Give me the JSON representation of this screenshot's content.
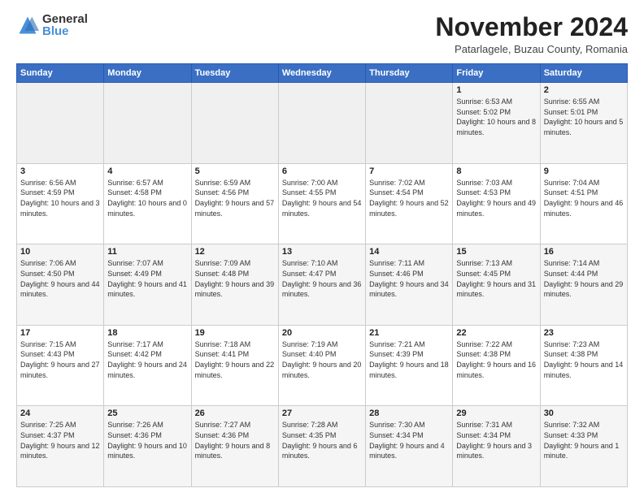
{
  "header": {
    "logo_general": "General",
    "logo_blue": "Blue",
    "month_title": "November 2024",
    "location": "Patarlagele, Buzau County, Romania"
  },
  "days_of_week": [
    "Sunday",
    "Monday",
    "Tuesday",
    "Wednesday",
    "Thursday",
    "Friday",
    "Saturday"
  ],
  "weeks": [
    [
      {
        "day": "",
        "info": ""
      },
      {
        "day": "",
        "info": ""
      },
      {
        "day": "",
        "info": ""
      },
      {
        "day": "",
        "info": ""
      },
      {
        "day": "",
        "info": ""
      },
      {
        "day": "1",
        "info": "Sunrise: 6:53 AM\nSunset: 5:02 PM\nDaylight: 10 hours and 8 minutes."
      },
      {
        "day": "2",
        "info": "Sunrise: 6:55 AM\nSunset: 5:01 PM\nDaylight: 10 hours and 5 minutes."
      }
    ],
    [
      {
        "day": "3",
        "info": "Sunrise: 6:56 AM\nSunset: 4:59 PM\nDaylight: 10 hours and 3 minutes."
      },
      {
        "day": "4",
        "info": "Sunrise: 6:57 AM\nSunset: 4:58 PM\nDaylight: 10 hours and 0 minutes."
      },
      {
        "day": "5",
        "info": "Sunrise: 6:59 AM\nSunset: 4:56 PM\nDaylight: 9 hours and 57 minutes."
      },
      {
        "day": "6",
        "info": "Sunrise: 7:00 AM\nSunset: 4:55 PM\nDaylight: 9 hours and 54 minutes."
      },
      {
        "day": "7",
        "info": "Sunrise: 7:02 AM\nSunset: 4:54 PM\nDaylight: 9 hours and 52 minutes."
      },
      {
        "day": "8",
        "info": "Sunrise: 7:03 AM\nSunset: 4:53 PM\nDaylight: 9 hours and 49 minutes."
      },
      {
        "day": "9",
        "info": "Sunrise: 7:04 AM\nSunset: 4:51 PM\nDaylight: 9 hours and 46 minutes."
      }
    ],
    [
      {
        "day": "10",
        "info": "Sunrise: 7:06 AM\nSunset: 4:50 PM\nDaylight: 9 hours and 44 minutes."
      },
      {
        "day": "11",
        "info": "Sunrise: 7:07 AM\nSunset: 4:49 PM\nDaylight: 9 hours and 41 minutes."
      },
      {
        "day": "12",
        "info": "Sunrise: 7:09 AM\nSunset: 4:48 PM\nDaylight: 9 hours and 39 minutes."
      },
      {
        "day": "13",
        "info": "Sunrise: 7:10 AM\nSunset: 4:47 PM\nDaylight: 9 hours and 36 minutes."
      },
      {
        "day": "14",
        "info": "Sunrise: 7:11 AM\nSunset: 4:46 PM\nDaylight: 9 hours and 34 minutes."
      },
      {
        "day": "15",
        "info": "Sunrise: 7:13 AM\nSunset: 4:45 PM\nDaylight: 9 hours and 31 minutes."
      },
      {
        "day": "16",
        "info": "Sunrise: 7:14 AM\nSunset: 4:44 PM\nDaylight: 9 hours and 29 minutes."
      }
    ],
    [
      {
        "day": "17",
        "info": "Sunrise: 7:15 AM\nSunset: 4:43 PM\nDaylight: 9 hours and 27 minutes."
      },
      {
        "day": "18",
        "info": "Sunrise: 7:17 AM\nSunset: 4:42 PM\nDaylight: 9 hours and 24 minutes."
      },
      {
        "day": "19",
        "info": "Sunrise: 7:18 AM\nSunset: 4:41 PM\nDaylight: 9 hours and 22 minutes."
      },
      {
        "day": "20",
        "info": "Sunrise: 7:19 AM\nSunset: 4:40 PM\nDaylight: 9 hours and 20 minutes."
      },
      {
        "day": "21",
        "info": "Sunrise: 7:21 AM\nSunset: 4:39 PM\nDaylight: 9 hours and 18 minutes."
      },
      {
        "day": "22",
        "info": "Sunrise: 7:22 AM\nSunset: 4:38 PM\nDaylight: 9 hours and 16 minutes."
      },
      {
        "day": "23",
        "info": "Sunrise: 7:23 AM\nSunset: 4:38 PM\nDaylight: 9 hours and 14 minutes."
      }
    ],
    [
      {
        "day": "24",
        "info": "Sunrise: 7:25 AM\nSunset: 4:37 PM\nDaylight: 9 hours and 12 minutes."
      },
      {
        "day": "25",
        "info": "Sunrise: 7:26 AM\nSunset: 4:36 PM\nDaylight: 9 hours and 10 minutes."
      },
      {
        "day": "26",
        "info": "Sunrise: 7:27 AM\nSunset: 4:36 PM\nDaylight: 9 hours and 8 minutes."
      },
      {
        "day": "27",
        "info": "Sunrise: 7:28 AM\nSunset: 4:35 PM\nDaylight: 9 hours and 6 minutes."
      },
      {
        "day": "28",
        "info": "Sunrise: 7:30 AM\nSunset: 4:34 PM\nDaylight: 9 hours and 4 minutes."
      },
      {
        "day": "29",
        "info": "Sunrise: 7:31 AM\nSunset: 4:34 PM\nDaylight: 9 hours and 3 minutes."
      },
      {
        "day": "30",
        "info": "Sunrise: 7:32 AM\nSunset: 4:33 PM\nDaylight: 9 hours and 1 minute."
      }
    ]
  ]
}
